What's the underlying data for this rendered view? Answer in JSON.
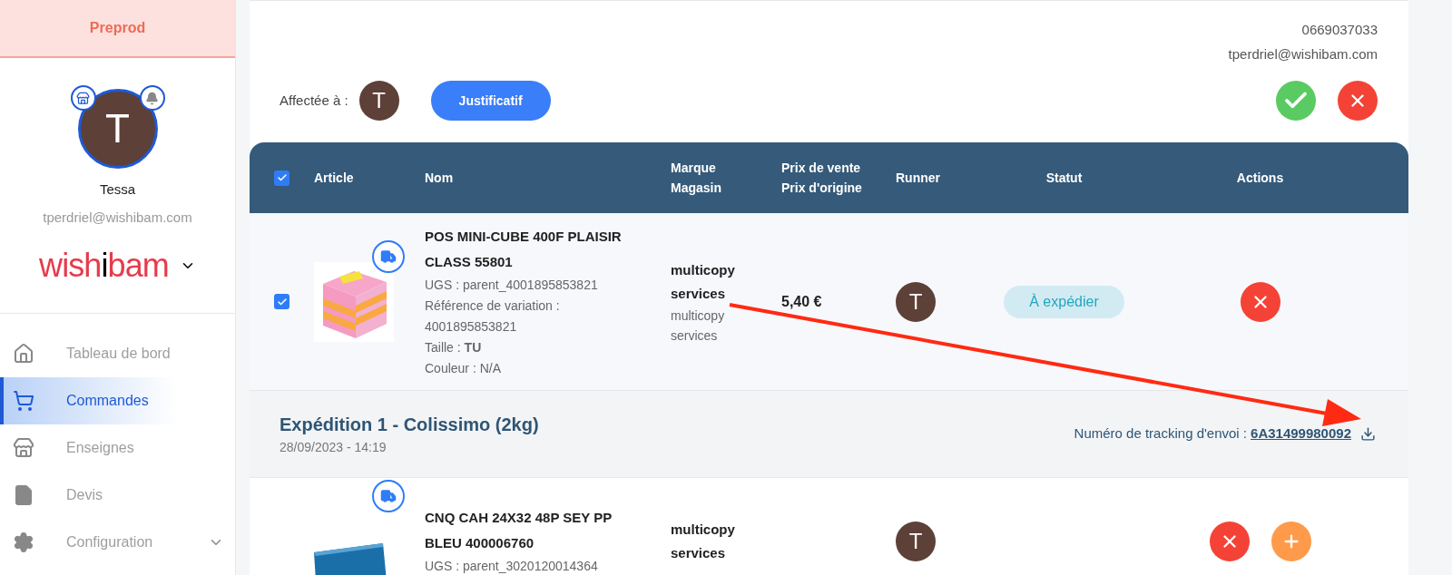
{
  "sidebar": {
    "environment": "Preprod",
    "user": {
      "initial": "T",
      "name": "Tessa",
      "email": "tperdriel@wishibam.com"
    },
    "brand": {
      "prefix": "wish",
      "accent": "i",
      "suffix": "bam"
    },
    "items": [
      {
        "label": "Tableau de bord",
        "selected": false,
        "expandable": false
      },
      {
        "label": "Commandes",
        "selected": true,
        "expandable": false
      },
      {
        "label": "Enseignes",
        "selected": false,
        "expandable": false
      },
      {
        "label": "Devis",
        "selected": false,
        "expandable": false
      },
      {
        "label": "Configuration",
        "selected": false,
        "expandable": true
      }
    ]
  },
  "contact": {
    "phone": "0669037033",
    "email": "tperdriel@wishibam.com"
  },
  "assignment": {
    "label": "Affectée à :",
    "initial": "T",
    "button": "Justificatif"
  },
  "table": {
    "all_checked": true,
    "columns": [
      {
        "lines": [
          "Article"
        ]
      },
      {
        "lines": [
          "Nom"
        ]
      },
      {
        "lines": [
          "Marque",
          "Magasin"
        ]
      },
      {
        "lines": [
          "Prix de vente",
          "Prix d'origine"
        ]
      },
      {
        "lines": [
          "Runner"
        ]
      },
      {
        "lines": [
          "Statut"
        ]
      },
      {
        "lines": [
          "Actions"
        ]
      }
    ],
    "rows": [
      {
        "checked": true,
        "name": "POS MINI-CUBE 400F PLAISIR CLASS 55801",
        "details": [
          "UGS : parent_4001895853821",
          "Référence de variation : 4001895853821",
          "Taille : **TU**",
          "Couleur : N/A"
        ],
        "brand": "multicopy services",
        "store": "multicopy services",
        "price": "5,40 €",
        "runner": "T",
        "status": "À expédier",
        "actions": [
          {
            "kind": "cancel"
          }
        ]
      },
      {
        "name": "CNQ CAH 24X32 48P SEY PP BLEU 400006760",
        "details": [
          "UGS : parent_3020120014364"
        ],
        "brand": "multicopy services",
        "runner": "T",
        "actions": [
          {
            "kind": "cancel"
          },
          {
            "kind": "add"
          }
        ]
      }
    ],
    "shipment": {
      "title": "Expédition 1 - Colissimo (2kg)",
      "date": "28/09/2023 - 14:19",
      "tracking_label": "Numéro de tracking d'envoi :",
      "tracking_number": "6A31499980092"
    }
  }
}
